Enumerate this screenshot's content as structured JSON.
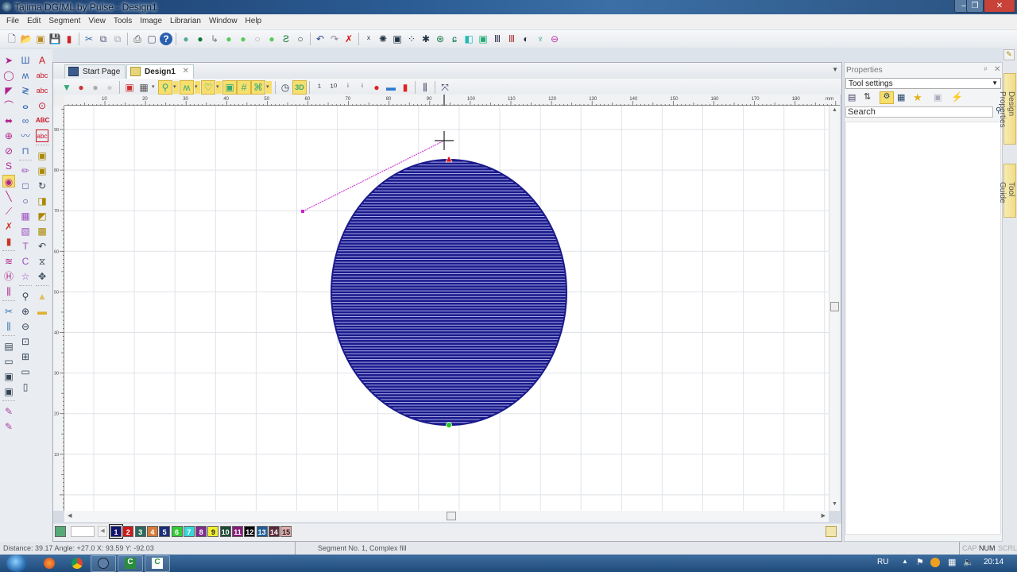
{
  "window": {
    "title": "Tajima DG/ML by Pulse - Design1",
    "controls": [
      "minimize",
      "restore",
      "close"
    ]
  },
  "menu": [
    "File",
    "Edit",
    "Segment",
    "View",
    "Tools",
    "Image",
    "Librarian",
    "Window",
    "Help"
  ],
  "toolbar_main": [
    "new-icon",
    "open-icon",
    "open-multiple-icon",
    "save-icon",
    "save-as-icon",
    "|",
    "cut-icon",
    "copy-icon",
    "paste-icon",
    "|",
    "print-icon",
    "print-preview-icon",
    "help-icon",
    "|",
    "stitch-player-icon",
    "stitch-record-icon",
    "path-icon",
    "chain-icon",
    "chain2-icon",
    "chain3-icon",
    "chain4-icon",
    "jump-icon",
    "circle-icon",
    "|",
    "undo-icon",
    "redo-icon",
    "delete-icon",
    "|",
    "convert-icon",
    "fill-pattern-icon",
    "frame-icon",
    "scatter-icon",
    "star-icon",
    "radial-icon",
    "spiral-icon",
    "region-icon",
    "image-frame-icon",
    "columns-icon",
    "columns2-icon",
    "globe-icon",
    "needle-icon",
    "minus-circle-icon"
  ],
  "tabs": [
    {
      "label": "Start Page",
      "active": false
    },
    {
      "label": "Design1",
      "active": true,
      "closable": true
    }
  ],
  "tab_dropdown": "▼",
  "design_toolbar": [
    "filter-icon",
    "add-segment-icon",
    "remove-segment-icon",
    "disabled-icon",
    "|",
    "color-view-icon",
    "grid-menu-icon",
    "zoom-tool-icon",
    "satin-icon",
    "heart-icon",
    "frame-tool-icon",
    "grid-icon",
    "command-icon",
    "|",
    "clock-icon",
    "3d-icon",
    "|",
    "step1-icon",
    "step10-icon",
    "step100-icon",
    "step1000-icon",
    "stop-icon",
    "trim-icon",
    "needle-down-icon",
    "|",
    "density-icon",
    "|",
    "split-icon"
  ],
  "ruler": {
    "unit": "mm",
    "h_ticks": [
      "10",
      "20",
      "30",
      "40",
      "50",
      "60",
      "70",
      "80",
      "90",
      "100",
      "110",
      "120",
      "130",
      "140",
      "150",
      "160",
      "170",
      "180"
    ],
    "v_ticks": [
      "90",
      "80",
      "70",
      "60",
      "50",
      "40",
      "30",
      "20",
      "10"
    ]
  },
  "canvas": {
    "object": "Complex fill ellipse",
    "fill_color": "#1a1a8c",
    "fill_highlight": "#a9a9e6",
    "start_marker_color": "#dd1111",
    "end_marker_color": "#22cc22",
    "measure_line_color": "#cc22cc"
  },
  "palette": {
    "swatches": [
      {
        "n": "1",
        "color": "#141470"
      },
      {
        "n": "2",
        "color": "#cc1b1b"
      },
      {
        "n": "3",
        "color": "#2c6b5c"
      },
      {
        "n": "4",
        "color": "#d67b3a"
      },
      {
        "n": "5",
        "color": "#1b2f7a"
      },
      {
        "n": "6",
        "color": "#33cc33"
      },
      {
        "n": "7",
        "color": "#3ad6d6"
      },
      {
        "n": "8",
        "color": "#7e2f8e"
      },
      {
        "n": "9",
        "color": "#f2ee30"
      },
      {
        "n": "10",
        "color": "#1f4a36"
      },
      {
        "n": "11",
        "color": "#8a1a7a"
      },
      {
        "n": "12",
        "color": "#0a0a0a"
      },
      {
        "n": "13",
        "color": "#1f5f99"
      },
      {
        "n": "14",
        "color": "#5c2a3a"
      },
      {
        "n": "15",
        "color": "#e3a9a9"
      }
    ],
    "selected": "1"
  },
  "properties": {
    "title": "Properties",
    "dropdown_value": "Tool settings",
    "search_placeholder": "Search",
    "toolbar": [
      "categorized-icon",
      "alphabetical-icon",
      "tool-settings-icon",
      "segment-props-icon",
      "favorites-icon",
      "disabled-props-icon",
      "lightning-icon"
    ]
  },
  "side_tabs": [
    "Design Properties",
    "Tool Guide"
  ],
  "status": {
    "left": "Distance: 39.17 Angle: +27.0 X: 93.59 Y: -92.03",
    "middle": "Segment No. 1, Complex fill",
    "caps": "CAP",
    "num": "NUM",
    "scrl": "SCRL"
  },
  "taskbar": {
    "apps": [
      "start-orb",
      "firefox-icon",
      "chrome-icon",
      "tajima-icon",
      "camtasia-icon",
      "camtasia2-icon"
    ],
    "language": "RU",
    "time": "20:14"
  }
}
